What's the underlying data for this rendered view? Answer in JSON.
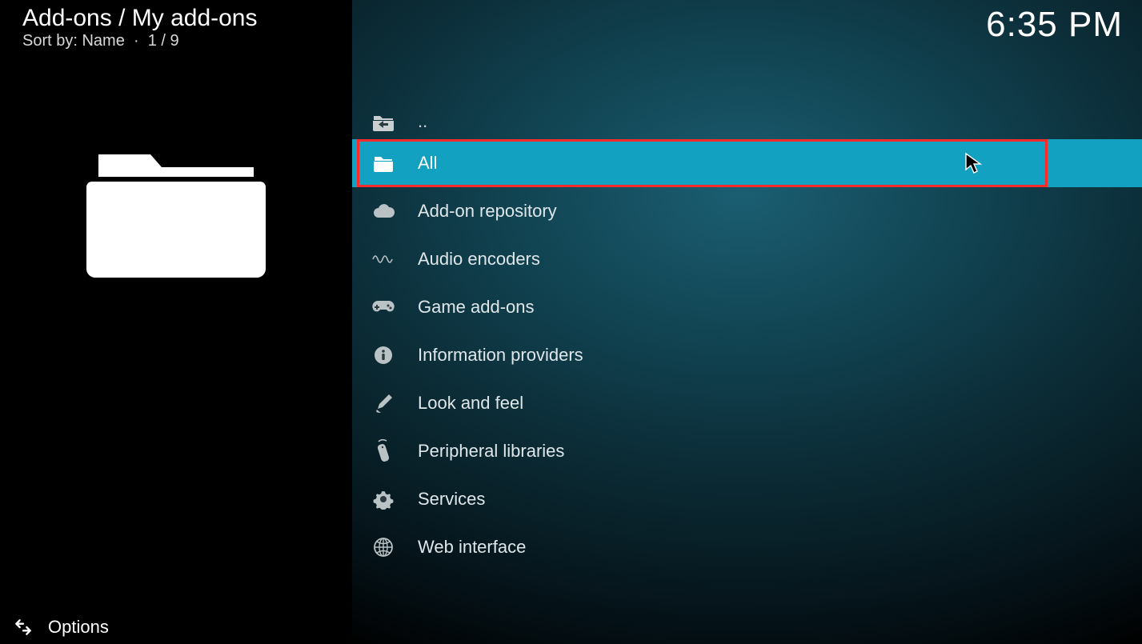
{
  "header": {
    "breadcrumb": "Add-ons / My add-ons",
    "sort_label": "Sort by: Name",
    "position": "1 / 9"
  },
  "clock": "6:35 PM",
  "parent_item": {
    "label": ".."
  },
  "items": [
    {
      "label": "All",
      "icon": "folder-icon",
      "selected": true,
      "highlighted": true
    },
    {
      "label": "Add-on repository",
      "icon": "cloud-icon"
    },
    {
      "label": "Audio encoders",
      "icon": "waveform-icon"
    },
    {
      "label": "Game add-ons",
      "icon": "gamepad-icon"
    },
    {
      "label": "Information providers",
      "icon": "info-icon"
    },
    {
      "label": "Look and feel",
      "icon": "paint-icon"
    },
    {
      "label": "Peripheral libraries",
      "icon": "remote-icon"
    },
    {
      "label": "Services",
      "icon": "gear-icon"
    },
    {
      "label": "Web interface",
      "icon": "globe-icon"
    }
  ],
  "footer": {
    "options_label": "Options"
  }
}
